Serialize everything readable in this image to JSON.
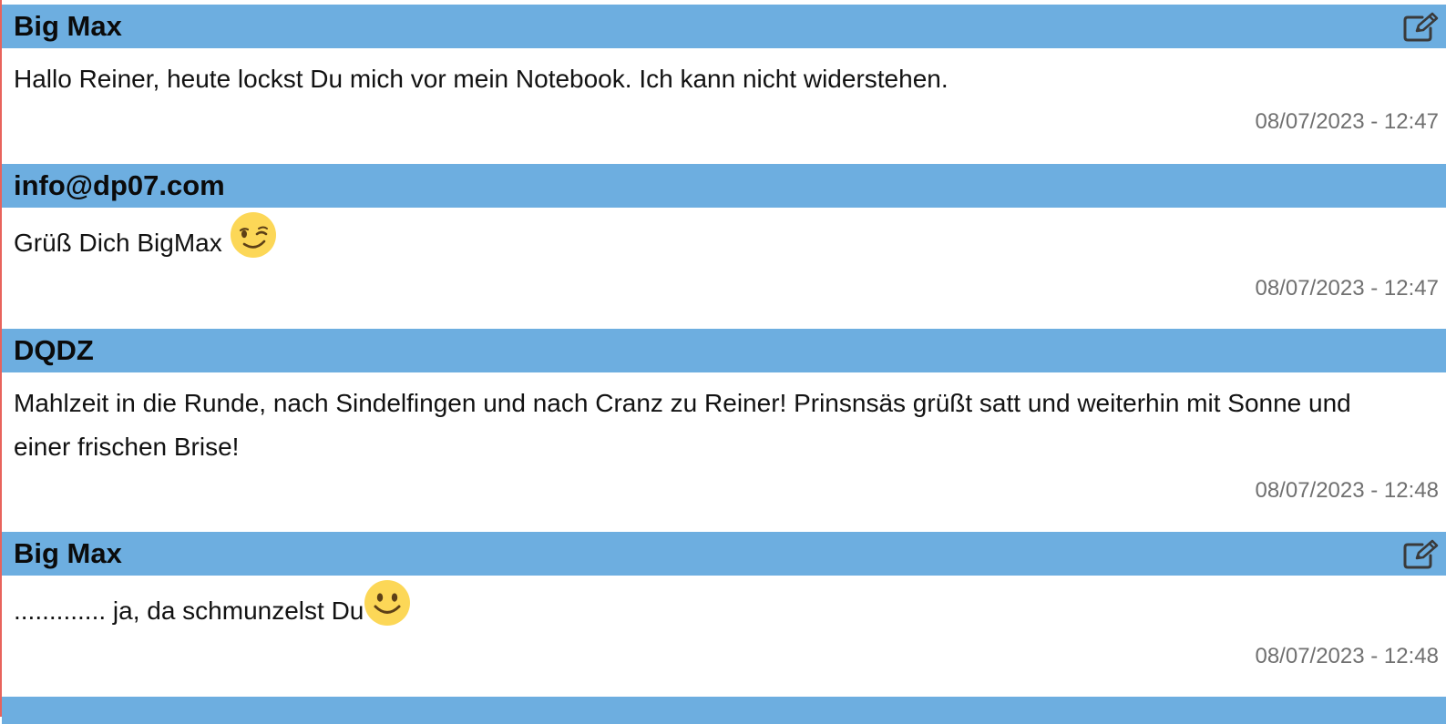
{
  "posts": [
    {
      "author": "Big Max",
      "message": "Hallo Reiner, heute lockst Du mich vor mein Notebook. Ich kann nicht widerstehen.",
      "timestamp": "08/07/2023 - 12:47",
      "editable": true
    },
    {
      "author": "info@dp07.com",
      "message": "Grüß Dich BigMax ",
      "emoji": "winking-face",
      "timestamp": "08/07/2023 - 12:47",
      "editable": false
    },
    {
      "author": "DQDZ",
      "message": "Mahlzeit in die Runde, nach Sindelfingen und nach Cranz zu Reiner! Prinsnsäs grüßt satt und weiterhin mit Sonne und einer frischen Brise!",
      "timestamp": "08/07/2023 - 12:48",
      "editable": false
    },
    {
      "author": "Big Max",
      "message": "............. ja, da schmunzelst Du",
      "emoji": "smiling-face",
      "timestamp": "08/07/2023 - 12:48",
      "editable": true
    }
  ],
  "colors": {
    "header_bar": "#6daee0",
    "author_text": "#0b0b0b",
    "timestamp_text": "#707070",
    "emoji_yellow": "#fcd757",
    "left_rule": "#e8635c"
  },
  "icons": {
    "edit": "edit-pencil-square-icon",
    "wink": "winking-face-emoji",
    "smile": "smiling-face-emoji"
  }
}
